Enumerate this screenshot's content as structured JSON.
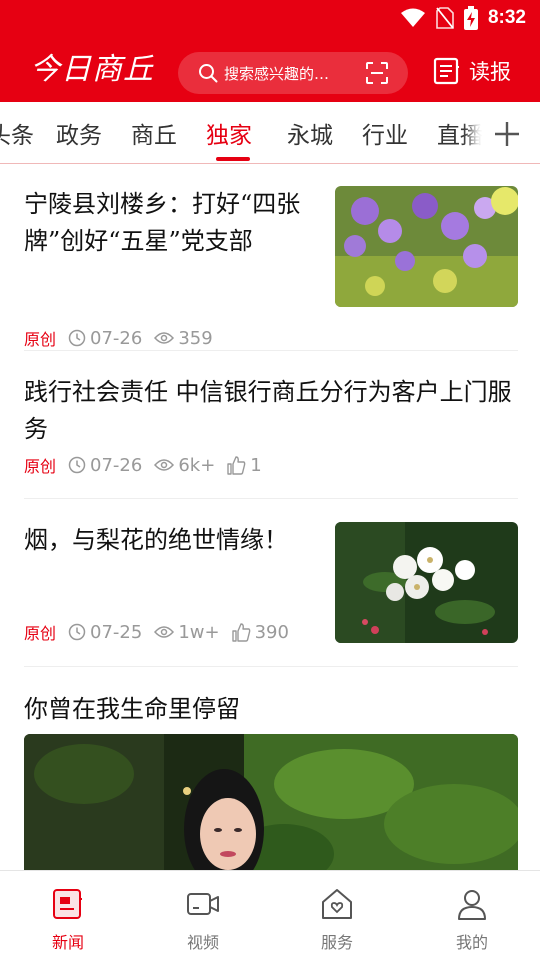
{
  "status_bar": {
    "time": "8:32",
    "icons": [
      "wifi-icon",
      "no-sim-icon",
      "battery-charging-icon"
    ]
  },
  "header": {
    "logo_text": "今日商丘",
    "search_placeholder": "搜索感兴趣的…",
    "read_label": "读报"
  },
  "tabs": {
    "items": [
      "头条",
      "政务",
      "商丘",
      "独家",
      "永城",
      "行业",
      "直播"
    ],
    "active": "独家"
  },
  "articles": [
    {
      "title": "宁陵县刘楼乡：打好“四张牌”创好“五星”党支部",
      "tag": "原创",
      "date": "07-26",
      "views": "359",
      "likes": "",
      "thumbnail": "purple-flowers-photo"
    },
    {
      "title": "践行社会责任  中信银行商丘分行为客户上门服务",
      "tag": "原创",
      "date": "07-26",
      "views": "6k+",
      "likes": "1",
      "thumbnail": ""
    },
    {
      "title": "烟，与梨花的绝世情缘！",
      "tag": "原创",
      "date": "07-25",
      "views": "1w+",
      "likes": "390",
      "thumbnail": "pear-blossom-photo"
    },
    {
      "title": "你曾在我生命里停留",
      "tag": "",
      "date": "",
      "views": "",
      "likes": "",
      "thumbnail": "woman-in-bamboo-forest-photo"
    }
  ],
  "bottom_nav": [
    {
      "label": "新闻",
      "icon": "news-icon",
      "active": true
    },
    {
      "label": "视频",
      "icon": "video-icon",
      "active": false
    },
    {
      "label": "服务",
      "icon": "service-home-icon",
      "active": false
    },
    {
      "label": "我的",
      "icon": "profile-icon",
      "active": false
    }
  ],
  "colors": {
    "brand": "#e60012",
    "meta": "#999999",
    "divider": "#eeeeee"
  }
}
